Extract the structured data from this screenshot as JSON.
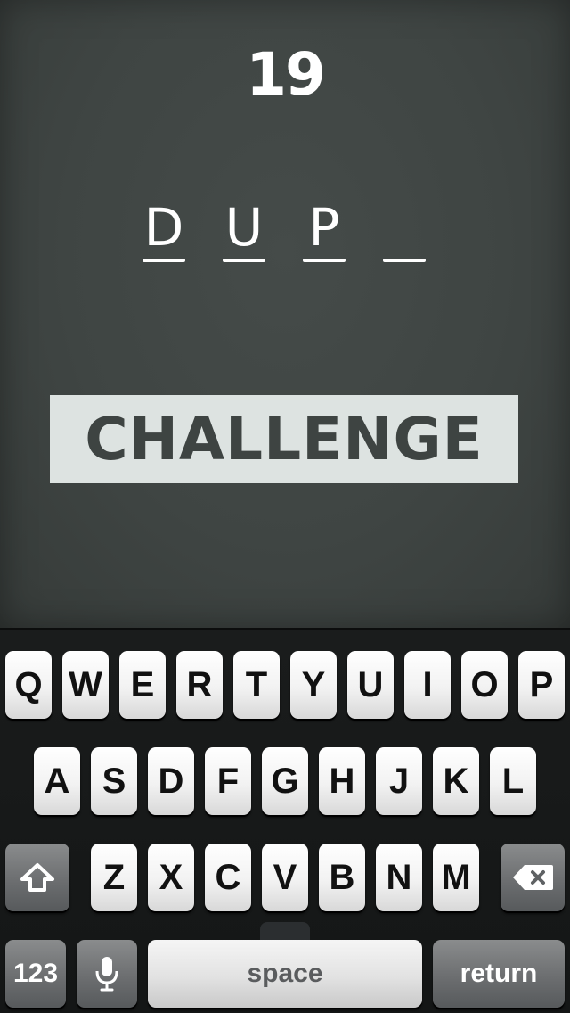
{
  "game": {
    "timer": "19",
    "letters": [
      "D",
      "U",
      "P",
      ""
    ],
    "word": "CHALLENGE"
  },
  "keyboard": {
    "row1": [
      "Q",
      "W",
      "E",
      "R",
      "T",
      "Y",
      "U",
      "I",
      "O",
      "P"
    ],
    "row2": [
      "A",
      "S",
      "D",
      "F",
      "G",
      "H",
      "J",
      "K",
      "L"
    ],
    "row3": [
      "Z",
      "X",
      "C",
      "V",
      "B",
      "N",
      "M"
    ],
    "numbers_label": "123",
    "space_label": "space",
    "return_label": "return",
    "icons": {
      "shift": "shift-arrow-icon",
      "backspace": "backspace-icon",
      "mic": "microphone-icon"
    }
  },
  "colors": {
    "background": "#3f4543",
    "banner_background": "#dde3e1",
    "banner_text": "#3e4442",
    "keyboard_background": "#161818"
  }
}
